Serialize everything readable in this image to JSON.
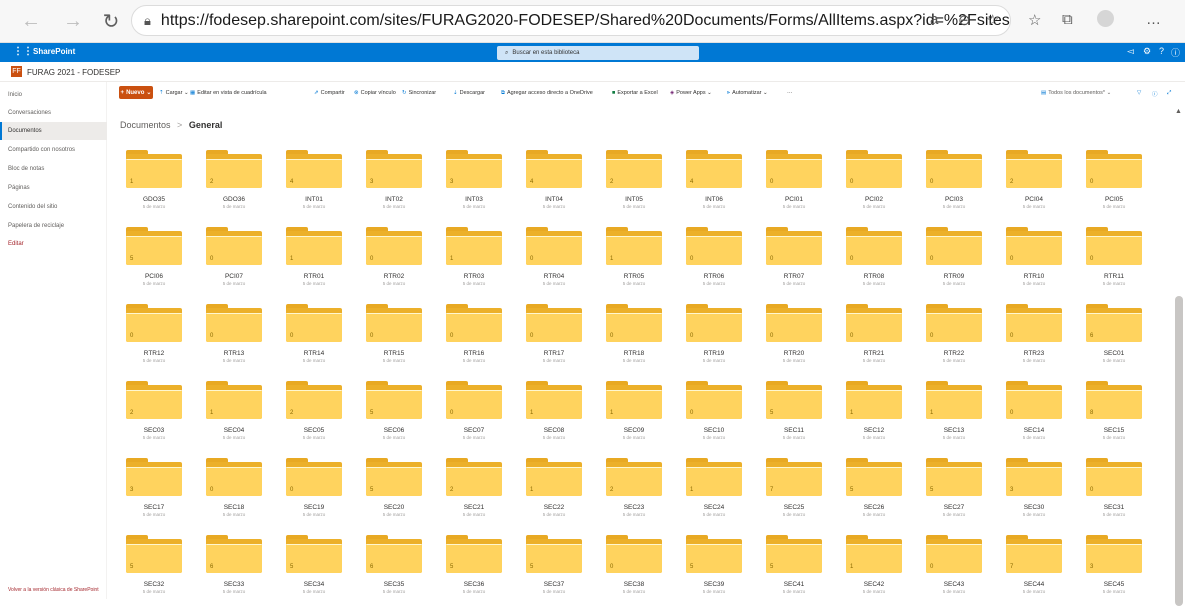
{
  "browser": {
    "url": "https://fodesep.sharepoint.com/sites/FURAG2020-FODESEP/Shared%20Documents/Forms/AllItems.aspx?id=%2Fsites%2F..."
  },
  "suite": {
    "brand": "SharePoint",
    "search_placeholder": "Buscar en esta biblioteca"
  },
  "site": {
    "logo_letter": "FF",
    "title": "FURAG 2021 - FODESEP"
  },
  "nav": {
    "items": [
      "Inicio",
      "Conversaciones",
      "Documentos",
      "Compartido con nosotros",
      "Bloc de notas",
      "Páginas",
      "Contenido del sitio",
      "Papelera de reciclaje",
      "Editar"
    ],
    "classic_link": "Volver a la versión clásica de SharePoint"
  },
  "commands": {
    "new": "Nuevo",
    "upload": "Cargar",
    "grid_edit": "Editar en vista de cuadrícula",
    "share": "Compartir",
    "copy_link": "Copiar vínculo",
    "sync": "Sincronizar",
    "download": "Descargar",
    "shortcut": "Agregar acceso directo a OneDrive",
    "excel": "Exportar a Excel",
    "power_apps": "Power Apps",
    "automate": "Automatizar",
    "more": "···",
    "view": "Todos los documentos*"
  },
  "breadcrumb": {
    "parent": "Documentos",
    "separator": ">",
    "current": "General"
  },
  "folders": [
    {
      "name": "GDO35",
      "count": "1",
      "date": "5 de marzo"
    },
    {
      "name": "GDO36",
      "count": "2",
      "date": "5 de marzo"
    },
    {
      "name": "INT01",
      "count": "4",
      "date": "5 de marzo"
    },
    {
      "name": "INT02",
      "count": "3",
      "date": "5 de marzo"
    },
    {
      "name": "INT03",
      "count": "3",
      "date": "5 de marzo"
    },
    {
      "name": "INT04",
      "count": "4",
      "date": "5 de marzo"
    },
    {
      "name": "INT05",
      "count": "2",
      "date": "5 de marzo"
    },
    {
      "name": "INT06",
      "count": "4",
      "date": "5 de marzo"
    },
    {
      "name": "PCI01",
      "count": "0",
      "date": "5 de marzo"
    },
    {
      "name": "PCI02",
      "count": "0",
      "date": "5 de marzo"
    },
    {
      "name": "PCI03",
      "count": "0",
      "date": "5 de marzo"
    },
    {
      "name": "PCI04",
      "count": "2",
      "date": "5 de marzo"
    },
    {
      "name": "PCI05",
      "count": "0",
      "date": "5 de marzo"
    },
    {
      "name": "PCI06",
      "count": "5",
      "date": "5 de marzo"
    },
    {
      "name": "PCI07",
      "count": "0",
      "date": "5 de marzo"
    },
    {
      "name": "RTR01",
      "count": "1",
      "date": "5 de marzo"
    },
    {
      "name": "RTR02",
      "count": "0",
      "date": "5 de marzo"
    },
    {
      "name": "RTR03",
      "count": "1",
      "date": "5 de marzo"
    },
    {
      "name": "RTR04",
      "count": "0",
      "date": "5 de marzo"
    },
    {
      "name": "RTR05",
      "count": "1",
      "date": "5 de marzo"
    },
    {
      "name": "RTR06",
      "count": "0",
      "date": "5 de marzo"
    },
    {
      "name": "RTR07",
      "count": "0",
      "date": "5 de marzo"
    },
    {
      "name": "RTR08",
      "count": "0",
      "date": "5 de marzo"
    },
    {
      "name": "RTR09",
      "count": "0",
      "date": "5 de marzo"
    },
    {
      "name": "RTR10",
      "count": "0",
      "date": "5 de marzo"
    },
    {
      "name": "RTR11",
      "count": "0",
      "date": "5 de marzo"
    },
    {
      "name": "RTR12",
      "count": "0",
      "date": "5 de marzo"
    },
    {
      "name": "RTR13",
      "count": "0",
      "date": "5 de marzo"
    },
    {
      "name": "RTR14",
      "count": "0",
      "date": "5 de marzo"
    },
    {
      "name": "RTR15",
      "count": "0",
      "date": "5 de marzo"
    },
    {
      "name": "RTR16",
      "count": "0",
      "date": "5 de marzo"
    },
    {
      "name": "RTR17",
      "count": "0",
      "date": "5 de marzo"
    },
    {
      "name": "RTR18",
      "count": "0",
      "date": "5 de marzo"
    },
    {
      "name": "RTR19",
      "count": "0",
      "date": "5 de marzo"
    },
    {
      "name": "RTR20",
      "count": "0",
      "date": "5 de marzo"
    },
    {
      "name": "RTR21",
      "count": "0",
      "date": "5 de marzo"
    },
    {
      "name": "RTR22",
      "count": "0",
      "date": "5 de marzo"
    },
    {
      "name": "RTR23",
      "count": "0",
      "date": "5 de marzo"
    },
    {
      "name": "SEC01",
      "count": "6",
      "date": "5 de marzo"
    },
    {
      "name": "SEC03",
      "count": "2",
      "date": "5 de marzo"
    },
    {
      "name": "SEC04",
      "count": "1",
      "date": "5 de marzo"
    },
    {
      "name": "SEC05",
      "count": "2",
      "date": "5 de marzo"
    },
    {
      "name": "SEC06",
      "count": "5",
      "date": "5 de marzo"
    },
    {
      "name": "SEC07",
      "count": "0",
      "date": "5 de marzo"
    },
    {
      "name": "SEC08",
      "count": "1",
      "date": "5 de marzo"
    },
    {
      "name": "SEC09",
      "count": "1",
      "date": "5 de marzo"
    },
    {
      "name": "SEC10",
      "count": "0",
      "date": "5 de marzo"
    },
    {
      "name": "SEC11",
      "count": "5",
      "date": "5 de marzo"
    },
    {
      "name": "SEC12",
      "count": "1",
      "date": "5 de marzo"
    },
    {
      "name": "SEC13",
      "count": "1",
      "date": "5 de marzo"
    },
    {
      "name": "SEC14",
      "count": "0",
      "date": "5 de marzo"
    },
    {
      "name": "SEC15",
      "count": "8",
      "date": "5 de marzo"
    },
    {
      "name": "SEC17",
      "count": "3",
      "date": "5 de marzo"
    },
    {
      "name": "SEC18",
      "count": "0",
      "date": "5 de marzo"
    },
    {
      "name": "SEC19",
      "count": "0",
      "date": "5 de marzo"
    },
    {
      "name": "SEC20",
      "count": "5",
      "date": "5 de marzo"
    },
    {
      "name": "SEC21",
      "count": "2",
      "date": "5 de marzo"
    },
    {
      "name": "SEC22",
      "count": "1",
      "date": "5 de marzo"
    },
    {
      "name": "SEC23",
      "count": "2",
      "date": "5 de marzo"
    },
    {
      "name": "SEC24",
      "count": "1",
      "date": "5 de marzo"
    },
    {
      "name": "SEC25",
      "count": "7",
      "date": "5 de marzo"
    },
    {
      "name": "SEC26",
      "count": "5",
      "date": "5 de marzo"
    },
    {
      "name": "SEC27",
      "count": "5",
      "date": "5 de marzo"
    },
    {
      "name": "SEC30",
      "count": "3",
      "date": "5 de marzo"
    },
    {
      "name": "SEC31",
      "count": "0",
      "date": "5 de marzo"
    },
    {
      "name": "SEC32",
      "count": "5",
      "date": "5 de marzo"
    },
    {
      "name": "SEC33",
      "count": "6",
      "date": "5 de marzo"
    },
    {
      "name": "SEC34",
      "count": "5",
      "date": "5 de marzo"
    },
    {
      "name": "SEC35",
      "count": "6",
      "date": "5 de marzo"
    },
    {
      "name": "SEC36",
      "count": "5",
      "date": "5 de marzo"
    },
    {
      "name": "SEC37",
      "count": "5",
      "date": "5 de marzo"
    },
    {
      "name": "SEC38",
      "count": "0",
      "date": "5 de marzo"
    },
    {
      "name": "SEC39",
      "count": "5",
      "date": "5 de marzo"
    },
    {
      "name": "SEC41",
      "count": "5",
      "date": "5 de marzo"
    },
    {
      "name": "SEC42",
      "count": "1",
      "date": "5 de marzo"
    },
    {
      "name": "SEC43",
      "count": "0",
      "date": "5 de marzo"
    },
    {
      "name": "SEC44",
      "count": "7",
      "date": "5 de marzo"
    },
    {
      "name": "SEC45",
      "count": "3",
      "date": "5 de marzo"
    }
  ]
}
